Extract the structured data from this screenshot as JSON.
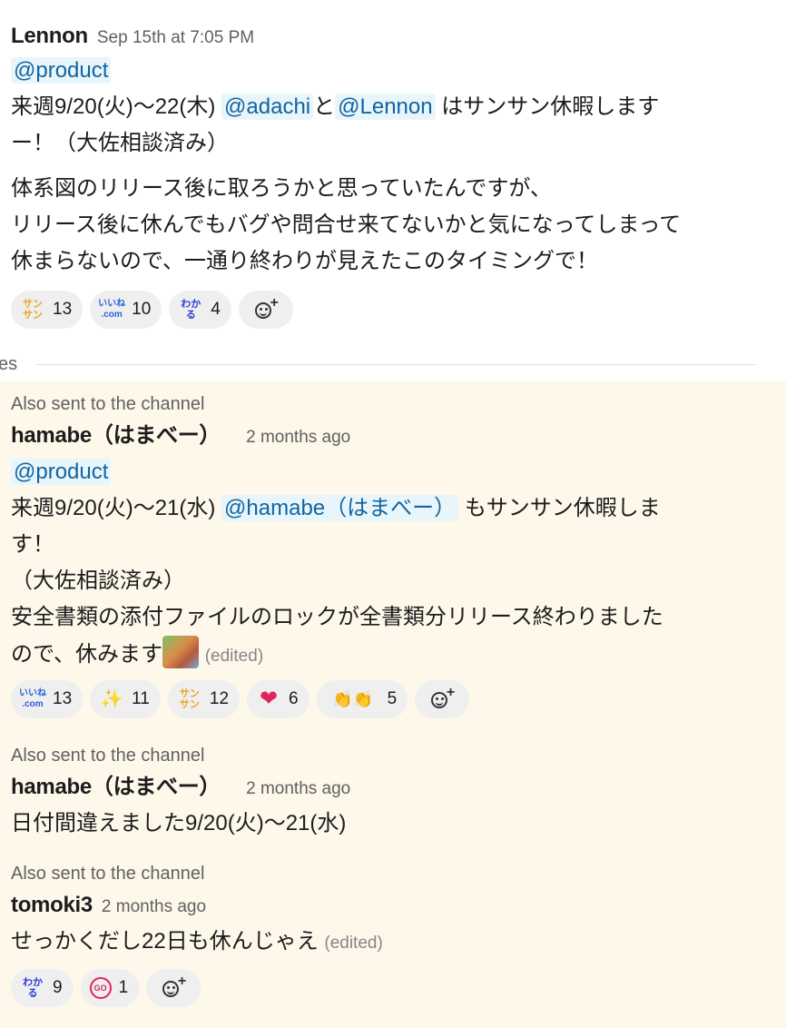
{
  "messages": [
    {
      "author": "Lennon",
      "timestamp": "Sep 15th at 7:05 PM",
      "mention_group": "@product",
      "line1_pre": "来週9/20(火)〜22(木)",
      "mention1": "@adachi",
      "conj": "と",
      "mention2": "@Lennon",
      "line1_post": "はサンサン休暇します",
      "line2": "ー！（大佐相談済み）",
      "para1": "体系図のリリース後に取ろうかと思っていたんですが、",
      "para2": "リリース後に休んでもバグや問合せ来てないかと気になってしまって",
      "para3": "休まらないので、一通り終わりが見えたこのタイミングで！",
      "reactions": [
        {
          "emoji": "sansan",
          "label": "サン\nサン",
          "count": "13"
        },
        {
          "emoji": "iine-com",
          "label": "いいね\n.com",
          "count": "10"
        },
        {
          "emoji": "wakaru",
          "label": "わか\nる",
          "count": "4"
        }
      ]
    },
    {
      "also_sent": "Also sent to the channel",
      "author": "hamabe（はまべー）",
      "timestamp": "2 months ago",
      "mention_group": "@product",
      "line1_pre": "来週9/20(火)〜21(水)",
      "mention1": "@hamabe（はまべー）",
      "line1_post": "もサンサン休暇しま",
      "line2": "す！",
      "line3": "（大佐相談済み）",
      "line4": "安全書類の添付ファイルのロックが全書類分リリース終わりました",
      "line5": "ので、休みます",
      "edited": "(edited)",
      "reactions": [
        {
          "emoji": "iine-com",
          "label": "いいね\n.com",
          "count": "13"
        },
        {
          "emoji": "sparkles",
          "label": "✨",
          "count": "11"
        },
        {
          "emoji": "sansan",
          "label": "サン\nサン",
          "count": "12"
        },
        {
          "emoji": "heart",
          "label": "❤",
          "count": "6"
        },
        {
          "emoji": "clap",
          "label": "👏👏",
          "count": "5"
        }
      ]
    },
    {
      "also_sent": "Also sent to the channel",
      "author": "hamabe（はまべー）",
      "timestamp": "2 months ago",
      "text": "日付間違えました9/20(火)〜21(水)"
    },
    {
      "also_sent": "Also sent to the channel",
      "author": "tomoki3",
      "timestamp": "2 months ago",
      "text": "せっかくだし22日も休んじゃえ",
      "edited": "(edited)",
      "reactions": [
        {
          "emoji": "wakaru",
          "label": "わか\nる",
          "count": "9"
        },
        {
          "emoji": "go",
          "label": "GO",
          "count": "1"
        }
      ]
    }
  ],
  "divider_label": "es",
  "colors": {
    "mention_bg": "#e8f5fa",
    "mention_fg": "#1264a3",
    "highlight_bg": "#fdf8ea",
    "pill_bg": "#efefef"
  }
}
